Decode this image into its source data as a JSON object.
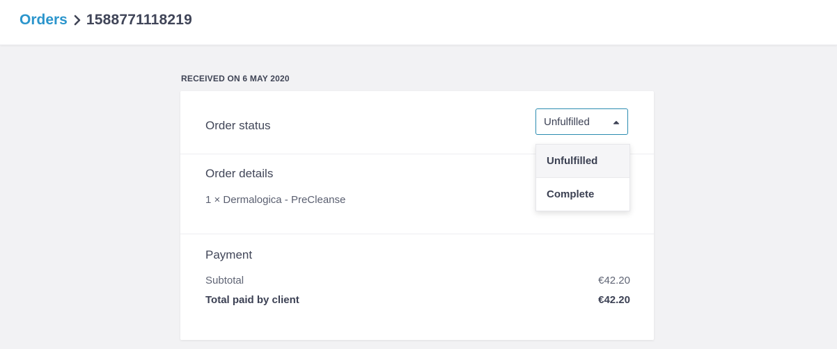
{
  "breadcrumb": {
    "parent": "Orders",
    "separator_icon": "chevron-right-icon",
    "current": "1588771118219"
  },
  "received_label": "RECEIVED ON 6 MAY 2020",
  "status": {
    "label": "Order status",
    "selected": "Unfulfilled",
    "options": [
      "Unfulfilled",
      "Complete"
    ],
    "accent_color": "#2a8bb0"
  },
  "details": {
    "title": "Order details",
    "items": [
      "1 × Dermalogica - PreCleanse"
    ]
  },
  "payment": {
    "title": "Payment",
    "subtotal_label": "Subtotal",
    "subtotal_value": "€42.20",
    "total_label": "Total paid by client",
    "total_value": "€42.20"
  },
  "colors": {
    "link": "#2b95cc",
    "background": "#f2f2f4"
  }
}
